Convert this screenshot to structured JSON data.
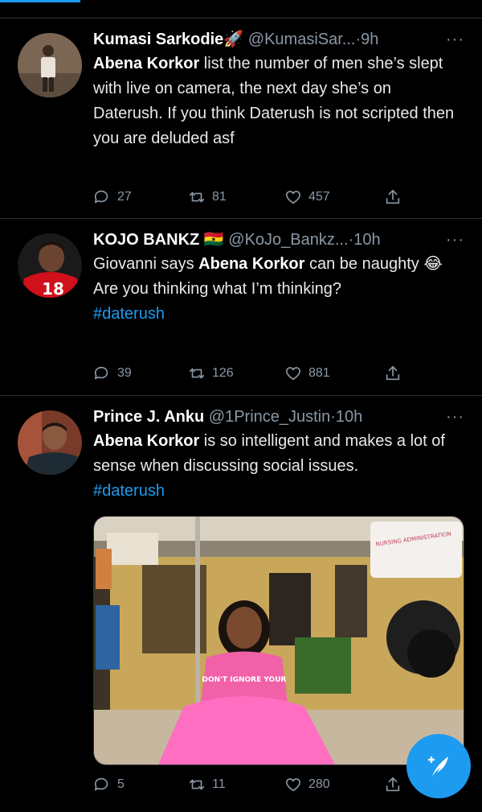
{
  "tweets": [
    {
      "name": "Kumasi Sarkodie",
      "name_emoji": "🚀",
      "handle": "@KumasiSar...",
      "time": "9h",
      "text_mention": "Abena Korkor",
      "text_body": " list the number of men she’s slept with live on camera, the next day she’s on Daterush. If you think Daterush is not scripted then you are deluded asf",
      "replies": "27",
      "retweets": "81",
      "likes": "457"
    },
    {
      "name": "KOJO BANKZ",
      "name_emoji": "🇬🇭",
      "handle": "@KoJo_Bankz...",
      "time": "10h",
      "text_pre": "Giovanni says ",
      "text_mention": "Abena Korkor",
      "text_mid": " can be naughty ",
      "text_emoji": "😂",
      "text_post": "Are you thinking what I’m thinking?",
      "hashtag": "#daterush",
      "replies": "39",
      "retweets": "126",
      "likes": "881",
      "jersey_number": "18"
    },
    {
      "name": "Prince J. Anku",
      "handle": "@1Prince_Justin",
      "time": "10h",
      "text_mention": "Abena Korkor",
      "text_body": " is so intelligent and makes a lot of sense when discussing social issues.",
      "hashtag": "#daterush",
      "replies": "5",
      "retweets": "11",
      "likes": "280",
      "media": {
        "sign_text": "NURSING ADMINISTRATION",
        "shirt_text": "DON'T IGNORE YOUR"
      }
    }
  ],
  "separator_dot": "·",
  "more_glyph": "···",
  "colors": {
    "accent": "#1d9bf0",
    "muted": "#8b98a5",
    "background": "#000000",
    "border": "#2f3336"
  }
}
